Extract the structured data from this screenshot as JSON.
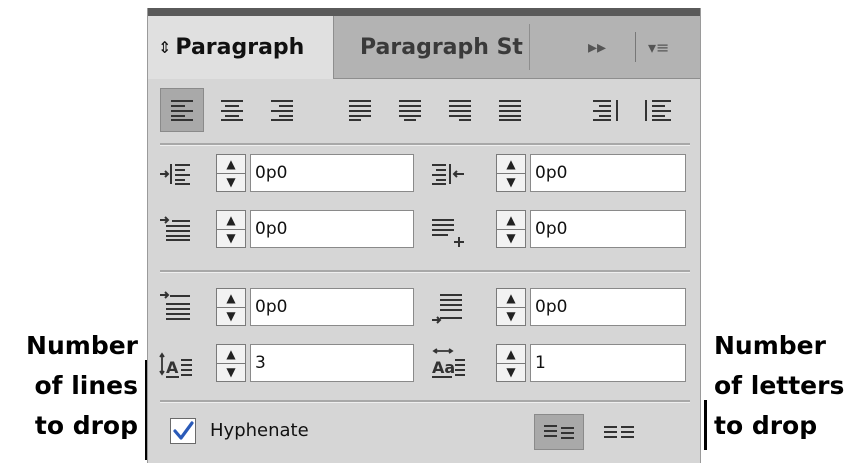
{
  "annotations": {
    "left_lines": [
      "Number",
      "of lines",
      "to drop"
    ],
    "right_lines": [
      "Number",
      "of letters",
      "to drop"
    ]
  },
  "panel": {
    "tabs": [
      {
        "label": "Paragraph",
        "active": true
      },
      {
        "label": "Paragraph St",
        "active": false
      }
    ],
    "tab_controls": {
      "expand_glyph": "▸▸",
      "menu_glyph": "▾≡"
    },
    "alignment_buttons": [
      {
        "name": "align-left",
        "selected": true
      },
      {
        "name": "align-center",
        "selected": false
      },
      {
        "name": "align-right",
        "selected": false
      },
      {
        "name": "justify-last-left",
        "selected": false
      },
      {
        "name": "justify-last-center",
        "selected": false
      },
      {
        "name": "justify-last-right",
        "selected": false
      },
      {
        "name": "justify-all",
        "selected": false
      },
      {
        "name": "align-towards-spine",
        "selected": false
      },
      {
        "name": "align-away-from-spine",
        "selected": false
      }
    ],
    "fields": {
      "left_indent": "0p0",
      "right_indent": "0p0",
      "first_line_indent": "0p0",
      "last_line_indent": "0p0",
      "space_before": "0p0",
      "space_after": "0p0",
      "drop_cap_lines": "3",
      "drop_cap_characters": "1"
    },
    "hyphenate": {
      "label": "Hyphenate",
      "checked": true
    },
    "colors": {
      "panel_bg": "#d6d6d6",
      "selected_bg": "#a9a9a9",
      "checkmark": "#2a5ab8"
    }
  }
}
